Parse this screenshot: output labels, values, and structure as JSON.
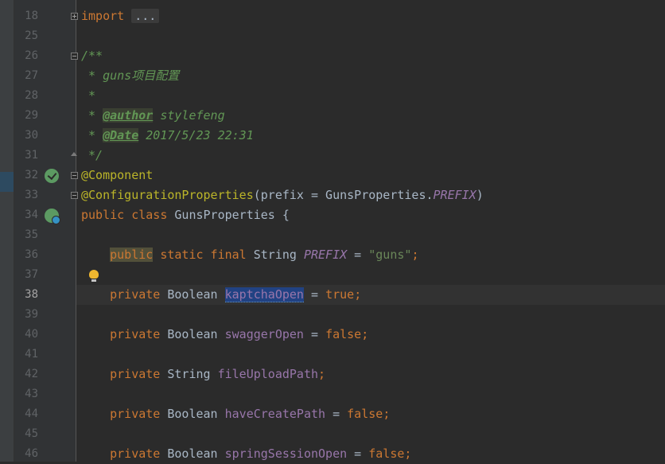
{
  "editor": {
    "lines": [
      {
        "num": "18",
        "segments": [
          {
            "t": "import",
            "c": "kw"
          },
          {
            "t": " ",
            "c": ""
          },
          {
            "t": "...",
            "c": "folded"
          }
        ]
      },
      {
        "num": "25",
        "segments": []
      },
      {
        "num": "26",
        "segments": [
          {
            "t": "/**",
            "c": "doc"
          }
        ]
      },
      {
        "num": "27",
        "segments": [
          {
            "t": " * guns项目配置",
            "c": "doc"
          }
        ]
      },
      {
        "num": "28",
        "segments": [
          {
            "t": " *",
            "c": "doc"
          }
        ]
      },
      {
        "num": "29",
        "segments": [
          {
            "t": " * ",
            "c": "doc"
          },
          {
            "t": "@author",
            "c": "doctag"
          },
          {
            "t": " stylefeng",
            "c": "doc"
          }
        ]
      },
      {
        "num": "30",
        "segments": [
          {
            "t": " * ",
            "c": "doc"
          },
          {
            "t": "@Date",
            "c": "doctag"
          },
          {
            "t": " 2017/5/23 22:31",
            "c": "doc"
          }
        ]
      },
      {
        "num": "31",
        "segments": [
          {
            "t": " */",
            "c": "doc"
          }
        ]
      },
      {
        "num": "32",
        "segments": [
          {
            "t": "@Component",
            "c": "ann"
          }
        ]
      },
      {
        "num": "33",
        "segments": [
          {
            "t": "@ConfigurationProperties",
            "c": "ann"
          },
          {
            "t": "(prefix = GunsProperties.",
            "c": "cls"
          },
          {
            "t": "PREFIX",
            "c": "const"
          },
          {
            "t": ")",
            "c": "cls"
          }
        ]
      },
      {
        "num": "34",
        "segments": [
          {
            "t": "public class",
            "c": "kw"
          },
          {
            "t": " GunsProperties {",
            "c": "cls"
          }
        ]
      },
      {
        "num": "35",
        "segments": []
      },
      {
        "num": "36",
        "segments": [
          {
            "t": "    ",
            "c": ""
          },
          {
            "t": "public",
            "c": "kw kw-hl"
          },
          {
            "t": " static final",
            "c": "kw"
          },
          {
            "t": " String ",
            "c": "cls"
          },
          {
            "t": "PREFIX",
            "c": "const"
          },
          {
            "t": " = ",
            "c": "cls"
          },
          {
            "t": "\"guns\"",
            "c": "str"
          },
          {
            "t": ";",
            "c": "kw"
          }
        ]
      },
      {
        "num": "37",
        "segments": []
      },
      {
        "num": "38",
        "segments": [
          {
            "t": "    ",
            "c": ""
          },
          {
            "t": "private",
            "c": "kw"
          },
          {
            "t": " Boolean ",
            "c": "cls"
          },
          {
            "t": "kaptchaOpen",
            "c": "field sel"
          },
          {
            "t": " = ",
            "c": "cls"
          },
          {
            "t": "true",
            "c": "kw"
          },
          {
            "t": ";",
            "c": "kw"
          }
        ]
      },
      {
        "num": "39",
        "segments": []
      },
      {
        "num": "40",
        "segments": [
          {
            "t": "    ",
            "c": ""
          },
          {
            "t": "private",
            "c": "kw"
          },
          {
            "t": " Boolean ",
            "c": "cls"
          },
          {
            "t": "swaggerOpen",
            "c": "field"
          },
          {
            "t": " = ",
            "c": "cls"
          },
          {
            "t": "false",
            "c": "kw"
          },
          {
            "t": ";",
            "c": "kw"
          }
        ]
      },
      {
        "num": "41",
        "segments": []
      },
      {
        "num": "42",
        "segments": [
          {
            "t": "    ",
            "c": ""
          },
          {
            "t": "private",
            "c": "kw"
          },
          {
            "t": " String ",
            "c": "cls"
          },
          {
            "t": "fileUploadPath",
            "c": "field"
          },
          {
            "t": ";",
            "c": "kw"
          }
        ]
      },
      {
        "num": "43",
        "segments": []
      },
      {
        "num": "44",
        "segments": [
          {
            "t": "    ",
            "c": ""
          },
          {
            "t": "private",
            "c": "kw"
          },
          {
            "t": " Boolean ",
            "c": "cls"
          },
          {
            "t": "haveCreatePath",
            "c": "field"
          },
          {
            "t": " = ",
            "c": "cls"
          },
          {
            "t": "false",
            "c": "kw"
          },
          {
            "t": ";",
            "c": "kw"
          }
        ]
      },
      {
        "num": "45",
        "segments": []
      },
      {
        "num": "46",
        "segments": [
          {
            "t": "    ",
            "c": ""
          },
          {
            "t": "private",
            "c": "kw"
          },
          {
            "t": " Boolean ",
            "c": "cls"
          },
          {
            "t": "springSessionOpen",
            "c": "field"
          },
          {
            "t": " = ",
            "c": "cls"
          },
          {
            "t": "false",
            "c": "kw"
          },
          {
            "t": ";",
            "c": "kw"
          }
        ]
      }
    ],
    "current_line": "38",
    "gutter_icons": {
      "32": "bean-icon",
      "34": "bean-implementation-icon"
    },
    "fold_markers": {
      "18": "plus",
      "26": "minus",
      "31": "end",
      "32": "minus",
      "33": "minus"
    },
    "intention": "lightbulb-icon"
  }
}
